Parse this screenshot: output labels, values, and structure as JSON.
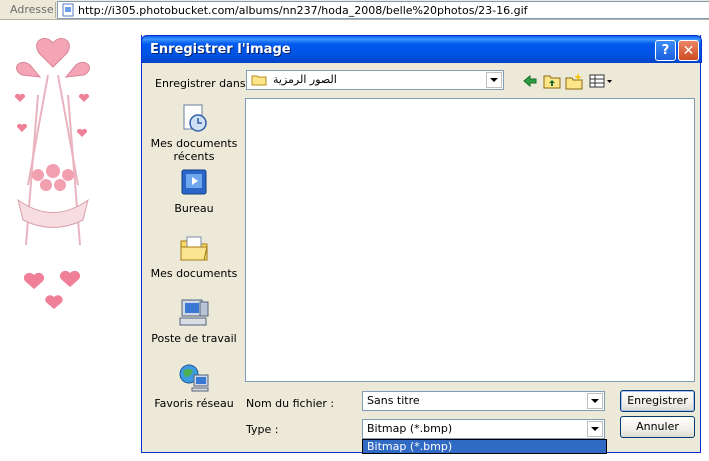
{
  "address_bar": {
    "label": "Adresse",
    "url": "http://i305.photobucket.com/albums/nn237/hoda_2008/belle%20photos/23-16.gif"
  },
  "dialog": {
    "title": "Enregistrer l'image",
    "help_icon": "help-icon",
    "close_icon": "close-icon",
    "save_in_label": "Enregistrer dans :",
    "save_in_value": "الصور الرمزية",
    "toolbar_icons": [
      "back-arrow-icon",
      "up-folder-icon",
      "new-folder-icon",
      "view-menu-icon"
    ],
    "places": [
      {
        "label": "Mes documents récents",
        "icon": "recent-documents-icon"
      },
      {
        "label": "Bureau",
        "icon": "desktop-icon"
      },
      {
        "label": "Mes documents",
        "icon": "my-documents-icon"
      },
      {
        "label": "Poste de travail",
        "icon": "my-computer-icon"
      },
      {
        "label": "Favoris réseau",
        "icon": "network-places-icon"
      }
    ],
    "filename_label": "Nom du fichier :",
    "filename_value": "Sans titre",
    "type_label": "Type :",
    "type_value": "Bitmap (*.bmp)",
    "type_dropdown_option": "Bitmap (*.bmp)",
    "save_button": "Enregistrer",
    "cancel_button": "Annuler"
  },
  "colors": {
    "titlebar": "#0054e3",
    "dialog_bg": "#ece9d8",
    "selection": "#316ac5"
  }
}
